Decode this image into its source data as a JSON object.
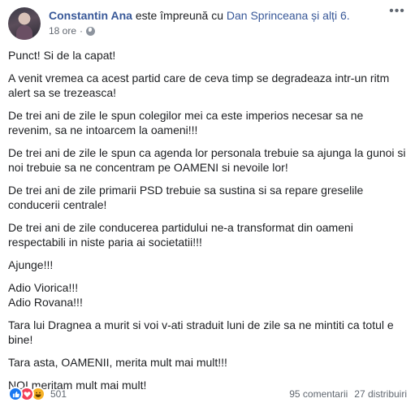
{
  "post": {
    "author": "Constantin Ana",
    "with_text": "este împreună cu",
    "tagged": "Dan Sprinceana și alți 6.",
    "time": "18 ore",
    "paragraphs": [
      "Punct! Si de la capat!",
      "A venit vremea ca acest partid care de ceva timp se degradeaza intr-un ritm alert sa se trezeasca!",
      "De trei ani de zile le spun colegilor mei ca este imperios necesar sa ne revenim, sa ne intoarcem la oameni!!!",
      "De trei ani de zile le spun ca agenda lor personala trebuie sa ajunga la gunoi si noi trebuie sa ne concentram pe OAMENI si nevoile lor!",
      "De trei ani de zile primarii PSD trebuie sa sustina si sa repare greselile conducerii centrale!",
      "De trei ani de zile conducerea partidului ne-a transformat din oameni respectabili in niste paria ai societatii!!!",
      "Ajunge!!!",
      "Adio Viorica!!!",
      "Adio Rovana!!!",
      "Tara lui Dragnea a murit si voi v-ati straduit luni de zile sa ne mintiti ca totul e bine!",
      "Tara asta, OAMENII, merita mult mai mult!!!",
      "NOI meritam mult mai mult!"
    ]
  },
  "footer": {
    "reaction_icons": [
      "like-icon",
      "love-icon",
      "haha-icon"
    ],
    "reaction_count": "501",
    "comments": "95 comentarii",
    "shares": "27 distribuiri"
  },
  "colors": {
    "link": "#385898",
    "text": "#1c1e21",
    "meta": "#616770",
    "like": "#1877f2",
    "love": "#f33e58",
    "haha": "#f7b125"
  }
}
